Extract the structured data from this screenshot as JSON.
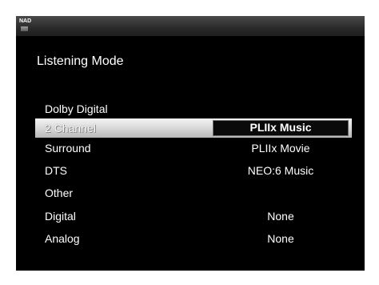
{
  "header": {
    "logo_text": "NAD"
  },
  "page": {
    "title": "Listening Mode"
  },
  "menu": {
    "selected_index": 1,
    "items": [
      {
        "label": "Dolby Digital",
        "value": ""
      },
      {
        "label": "2 Channel",
        "value": "PLIIx Music"
      },
      {
        "label": "Surround",
        "value": "PLIIx Movie"
      },
      {
        "label": "DTS",
        "value": "NEO:6 Music"
      },
      {
        "label": "Other",
        "value": ""
      },
      {
        "label": "Digital",
        "value": "None"
      },
      {
        "label": "Analog",
        "value": "None"
      }
    ]
  },
  "colors": {
    "background": "#000000",
    "text": "#ffffff",
    "highlight": "#d6d6d6",
    "selected_value_box": "#0a0a0a"
  }
}
